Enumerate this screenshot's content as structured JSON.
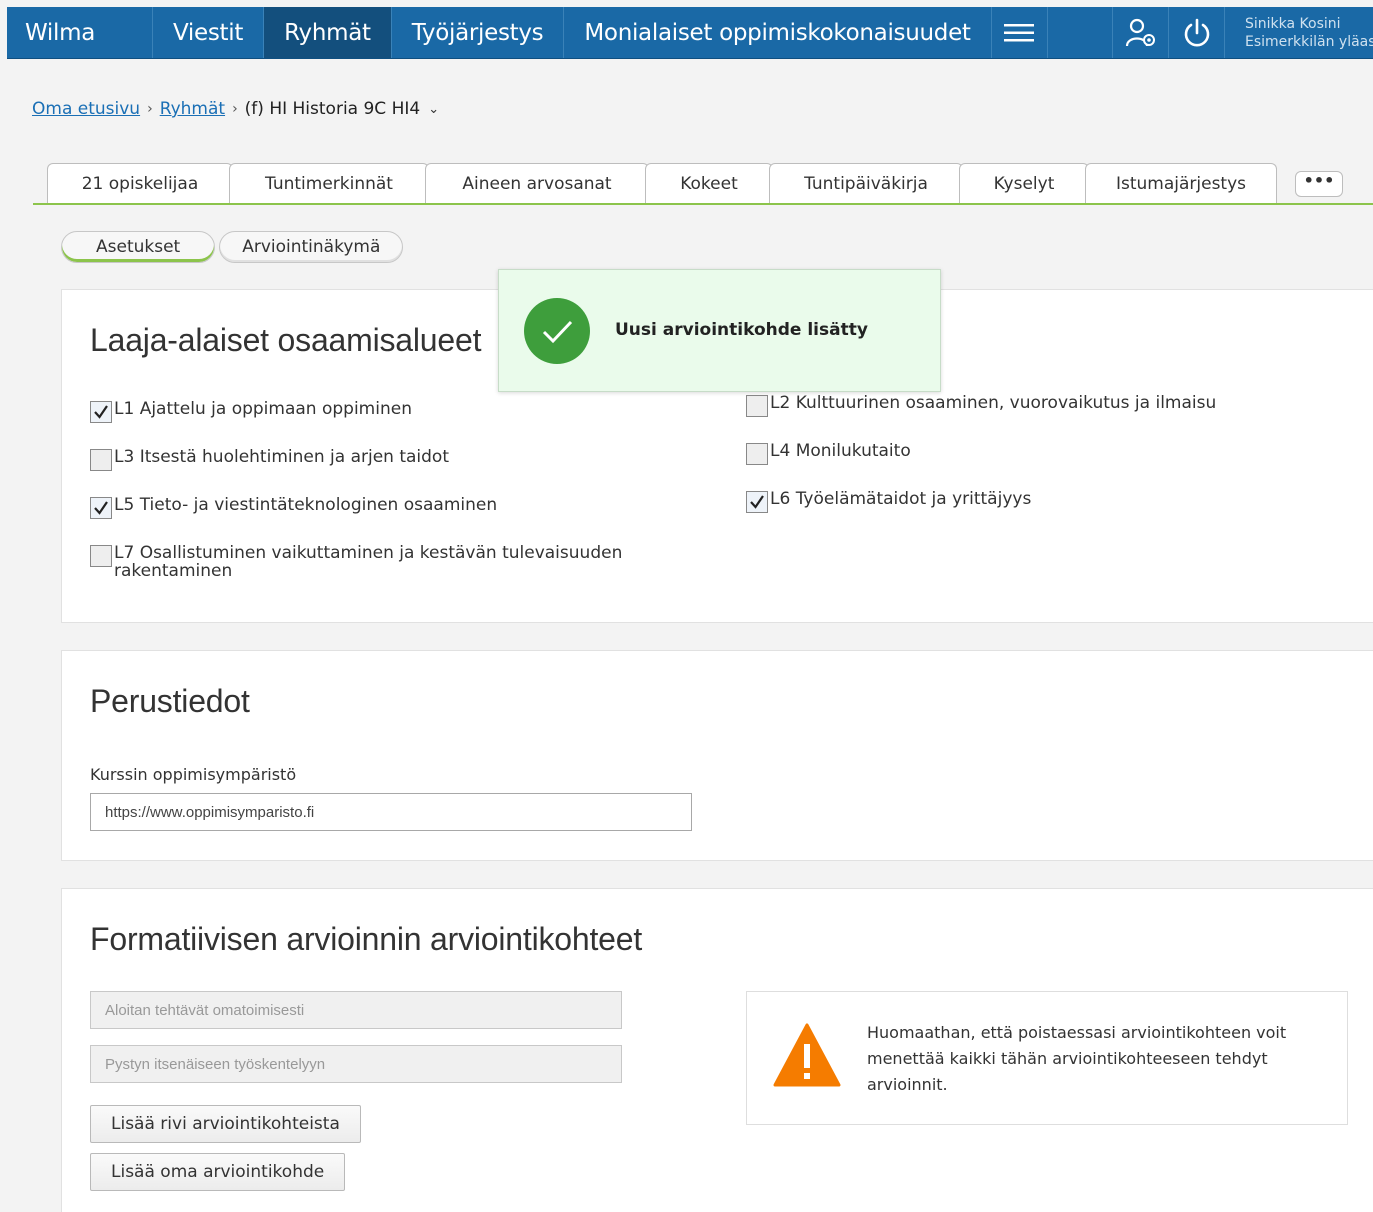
{
  "nav": {
    "brand": "Wilma",
    "items": [
      "Viestit",
      "Ryhmät",
      "Työjärjestys",
      "Monialaiset oppimiskokonaisuudet"
    ],
    "active": "Ryhmät",
    "user_name": "Sinikka Kosini",
    "user_school": "Esimerkkilän yläaste"
  },
  "breadcrumb": {
    "home": "Oma etusivu",
    "groups": "Ryhmät",
    "current": "(f) HI Historia 9C HI4"
  },
  "tabs": [
    "21 opiskelijaa",
    "Tuntimerkinnät",
    "Aineen arvosanat",
    "Kokeet",
    "Tuntipäiväkirja",
    "Kyselyt",
    "Istumajärjestys"
  ],
  "tab_more": "•••",
  "subtabs": {
    "settings": "Asetukset",
    "assessment_view": "Arviointinäkymä"
  },
  "competences": {
    "title": "Laaja-alaiset osaamisalueet",
    "items": [
      {
        "label": "L1 Ajattelu ja oppimaan oppiminen",
        "checked": true
      },
      {
        "label": "L2 Kulttuurinen osaaminen, vuorovaikutus ja ilmaisu",
        "checked": false
      },
      {
        "label": "L3 Itsestä huolehtiminen ja arjen taidot",
        "checked": false
      },
      {
        "label": "L4 Monilukutaito",
        "checked": false
      },
      {
        "label": "L5 Tieto- ja viestintäteknologinen osaaminen",
        "checked": true
      },
      {
        "label": "L6 Työelämätaidot ja yrittäjyys",
        "checked": true
      },
      {
        "label": "L7 Osallistuminen vaikuttaminen ja kestävän tulevaisuuden rakentaminen",
        "checked": false
      }
    ]
  },
  "basic": {
    "title": "Perustiedot",
    "env_label": "Kurssin oppimisympäristö",
    "env_value": "https://www.oppimisymparisto.fi"
  },
  "formative": {
    "title": "Formatiivisen arvioinnin arviointikohteet",
    "targets": [
      "Aloitan tehtävät omatoimisesti",
      "Pystyn itsenäiseen työskentelyyn"
    ],
    "add_row": "Lisää rivi arviointikohteista",
    "add_own": "Lisää oma arviointikohde",
    "warning": "Huomaathan, että poistaessasi arviointikohteen voit menettää kaikki tähän arviointikohteeseen tehdyt arvioinnit."
  },
  "toast": {
    "message": "Uusi arviointikohde lisätty"
  },
  "colors": {
    "nav": "#1a69a6",
    "accent": "#8cc44b",
    "success": "#3e9e3c",
    "warning": "#f57c00"
  }
}
